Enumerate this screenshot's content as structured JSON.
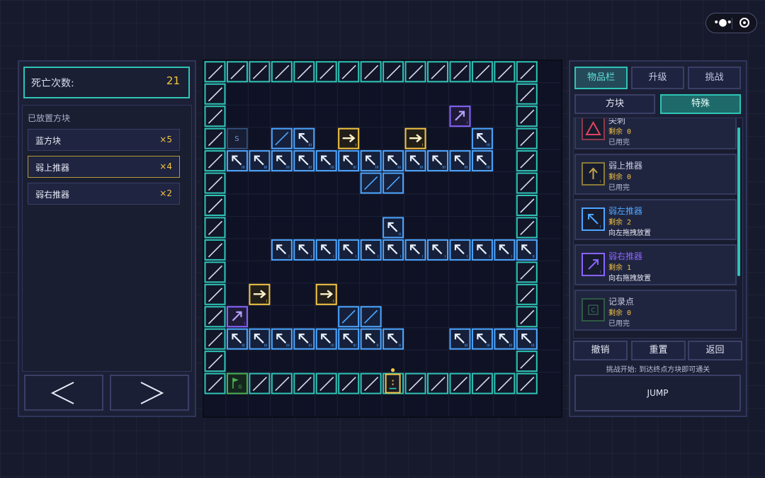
{
  "colors": {
    "teal": "#2ec4b6",
    "blue": "#4da6ff",
    "yellow": "#f5c542",
    "purple": "#8a63ff",
    "green": "#4caf50",
    "red": "#e0455e",
    "brown": "#c4a24a"
  },
  "death": {
    "label": "死亡次数:",
    "count": "21"
  },
  "placed": {
    "title": "已放置方块",
    "items": [
      {
        "name": "蓝方块",
        "count": "×5"
      },
      {
        "name": "弱上推器",
        "count": "×4"
      },
      {
        "name": "弱右推器",
        "count": "×2"
      }
    ]
  },
  "nav": {
    "prev": "<",
    "next": ">"
  },
  "tabs": [
    "物品栏",
    "升级",
    "挑战"
  ],
  "subtabs": [
    "方块",
    "特殊"
  ],
  "cards": [
    {
      "name": "尖刺",
      "remain": "剩余 0",
      "status": "已用完",
      "icon": "triangle-icon"
    },
    {
      "name": "弱上推器",
      "remain": "剩余 0",
      "status": "已用完",
      "icon": "arrow-up-icon"
    },
    {
      "name": "弱左推器",
      "remain": "剩余 2",
      "status": "向左拖拽放置",
      "icon": "arrow-up-left-icon"
    },
    {
      "name": "弱右推器",
      "remain": "剩余 1",
      "status": "向右拖拽放置",
      "icon": "arrow-up-right-icon"
    },
    {
      "name": "记录点",
      "remain": "剩余 0",
      "status": "已用完",
      "icon": "checkpoint-icon",
      "glyph": "C"
    }
  ],
  "actions": [
    "撤销",
    "重置",
    "返回"
  ],
  "hint": "挑战开始: 到达终点方块即可通关",
  "jump": "JUMP",
  "board": {
    "cols": 15,
    "rows": 15,
    "legend": {
      "W": "wall",
      "S": "start",
      "B": "blue-block",
      "L": "left-pusher",
      "R": "right-pusher",
      "P": "purple-pusher",
      "G": "goal",
      "K": "player"
    },
    "tiles": [
      {
        "c": 1,
        "r": 3,
        "t": "S",
        "label": "S"
      },
      {
        "c": 3,
        "r": 3,
        "t": "B"
      },
      {
        "c": 4,
        "r": 3,
        "t": "L",
        "sub": "III"
      },
      {
        "c": 6,
        "r": 3,
        "t": "R",
        "sub": "I"
      },
      {
        "c": 9,
        "r": 3,
        "t": "R",
        "sub": "I"
      },
      {
        "c": 12,
        "r": 3,
        "t": "L",
        "sub": "III"
      },
      {
        "c": 11,
        "r": 2,
        "t": "P",
        "sub": "I"
      },
      {
        "c": 1,
        "r": 4,
        "t": "L",
        "sub": "III"
      },
      {
        "c": 2,
        "r": 4,
        "t": "L",
        "sub": "III"
      },
      {
        "c": 3,
        "r": 4,
        "t": "L",
        "sub": "III"
      },
      {
        "c": 4,
        "r": 4,
        "t": "L",
        "sub": "III"
      },
      {
        "c": 5,
        "r": 4,
        "t": "L",
        "sub": "III"
      },
      {
        "c": 6,
        "r": 4,
        "t": "L",
        "sub": "III"
      },
      {
        "c": 7,
        "r": 4,
        "t": "L",
        "sub": "III"
      },
      {
        "c": 8,
        "r": 4,
        "t": "L",
        "sub": "III"
      },
      {
        "c": 9,
        "r": 4,
        "t": "L",
        "sub": "III"
      },
      {
        "c": 10,
        "r": 4,
        "t": "L",
        "sub": "III"
      },
      {
        "c": 11,
        "r": 4,
        "t": "L",
        "sub": "III"
      },
      {
        "c": 12,
        "r": 4,
        "t": "L",
        "sub": "III"
      },
      {
        "c": 7,
        "r": 5,
        "t": "B"
      },
      {
        "c": 8,
        "r": 5,
        "t": "B"
      },
      {
        "c": 8,
        "r": 7,
        "t": "L",
        "sub": "II"
      },
      {
        "c": 3,
        "r": 8,
        "t": "L",
        "sub": "I"
      },
      {
        "c": 4,
        "r": 8,
        "t": "L",
        "sub": "I"
      },
      {
        "c": 5,
        "r": 8,
        "t": "L",
        "sub": "I"
      },
      {
        "c": 6,
        "r": 8,
        "t": "L",
        "sub": "I"
      },
      {
        "c": 7,
        "r": 8,
        "t": "L",
        "sub": "I"
      },
      {
        "c": 8,
        "r": 8,
        "t": "L",
        "sub": "I"
      },
      {
        "c": 9,
        "r": 8,
        "t": "L",
        "sub": "I"
      },
      {
        "c": 10,
        "r": 8,
        "t": "L",
        "sub": "I"
      },
      {
        "c": 11,
        "r": 8,
        "t": "L",
        "sub": "I"
      },
      {
        "c": 12,
        "r": 8,
        "t": "L",
        "sub": "I"
      },
      {
        "c": 13,
        "r": 8,
        "t": "L",
        "sub": "I"
      },
      {
        "c": 14,
        "r": 8,
        "t": "L",
        "sub": "II"
      },
      {
        "c": 2,
        "r": 10,
        "t": "R",
        "sub": "I"
      },
      {
        "c": 5,
        "r": 10,
        "t": "R",
        "sub": "I"
      },
      {
        "c": 1,
        "r": 11,
        "t": "P",
        "sub": "I"
      },
      {
        "c": 6,
        "r": 11,
        "t": "B"
      },
      {
        "c": 7,
        "r": 11,
        "t": "B"
      },
      {
        "c": 1,
        "r": 12,
        "t": "L",
        "sub": "III"
      },
      {
        "c": 2,
        "r": 12,
        "t": "L",
        "sub": "III"
      },
      {
        "c": 3,
        "r": 12,
        "t": "L",
        "sub": "III"
      },
      {
        "c": 4,
        "r": 12,
        "t": "L",
        "sub": "III"
      },
      {
        "c": 5,
        "r": 12,
        "t": "L",
        "sub": "III"
      },
      {
        "c": 6,
        "r": 12,
        "t": "L",
        "sub": "III"
      },
      {
        "c": 7,
        "r": 12,
        "t": "L",
        "sub": "II"
      },
      {
        "c": 8,
        "r": 12,
        "t": "L",
        "sub": "II"
      },
      {
        "c": 11,
        "r": 12,
        "t": "L",
        "sub": "III"
      },
      {
        "c": 12,
        "r": 12,
        "t": "L",
        "sub": "III"
      },
      {
        "c": 13,
        "r": 12,
        "t": "L",
        "sub": "III"
      },
      {
        "c": 14,
        "r": 12,
        "t": "L",
        "sub": "III"
      },
      {
        "c": 1,
        "r": 14,
        "t": "G",
        "label": "G"
      },
      {
        "c": 8,
        "r": 14,
        "t": "K"
      }
    ]
  }
}
